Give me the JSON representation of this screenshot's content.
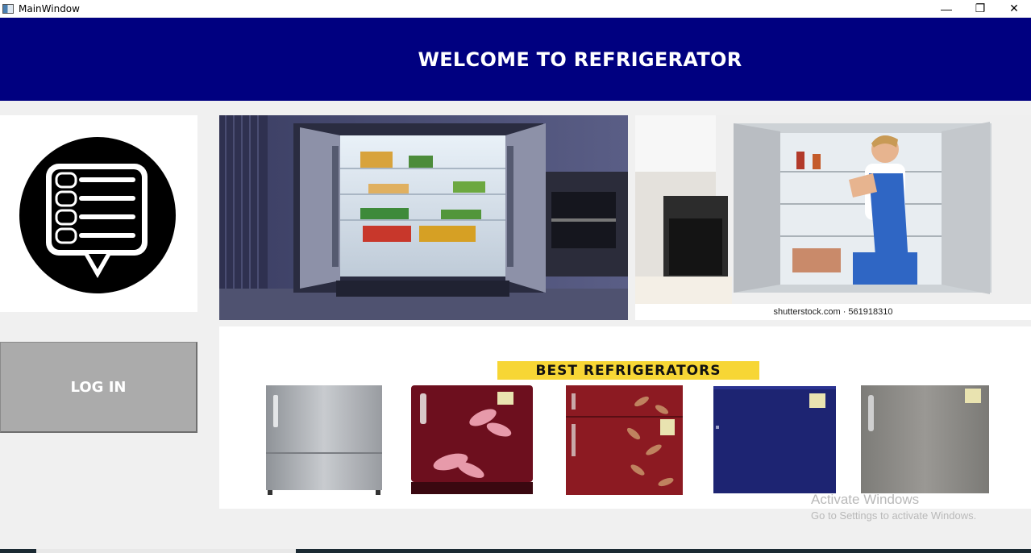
{
  "window": {
    "title": "MainWindow",
    "minimize_glyph": "—",
    "restore_glyph": "❐",
    "close_glyph": "✕"
  },
  "header": {
    "title": "WELCOME TO REFRIGERATOR"
  },
  "sidebar": {
    "logo_icon": "list-chat-bubble-icon",
    "login_label": "LOG IN"
  },
  "gallery": {
    "photo1_desc_icon": "open-fridge-photo",
    "photo2_desc_icon": "technician-repair-photo",
    "photo2_caption": "shutterstock.com · 561918310"
  },
  "products": {
    "banner": "BEST REFRIGERATORS",
    "items": [
      {
        "name": "silver-single-door",
        "color": "#a9acb1"
      },
      {
        "name": "maroon-floral-single-door",
        "color": "#6d0f1e"
      },
      {
        "name": "red-floral-double-door",
        "color": "#8c1a22"
      },
      {
        "name": "navy-single-door",
        "color": "#1d2472"
      },
      {
        "name": "grey-single-door",
        "color": "#8b8a86"
      }
    ]
  },
  "watermark": {
    "line1": "Activate Windows",
    "line2": "Go to Settings to activate Windows."
  },
  "colors": {
    "header_bg": "#000080",
    "banner_bg": "#f7d635",
    "login_bg": "#ababab"
  }
}
